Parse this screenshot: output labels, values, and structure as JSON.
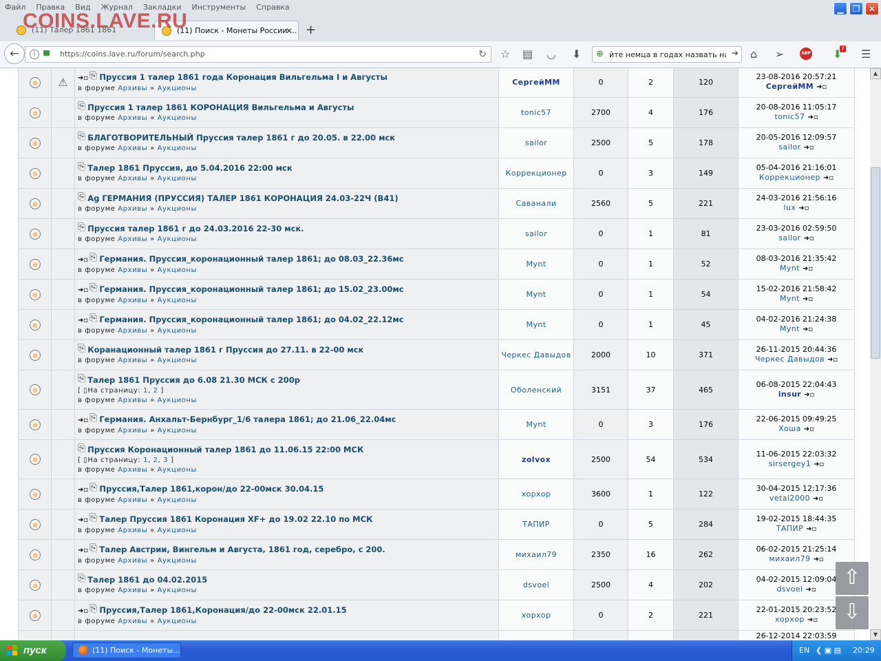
{
  "menu": [
    "Файл",
    "Правка",
    "Вид",
    "Журнал",
    "Закладки",
    "Инструменты",
    "Справка"
  ],
  "watermark": "COINS.LAVE.RU",
  "tabs": [
    {
      "label": "(11) Талер 1861 1861"
    },
    {
      "label": "(11) Поиск - Монеты России ..."
    }
  ],
  "address": {
    "url": "https://coins.lave.ru/forum/search.php"
  },
  "search": {
    "value": "йте немца в годах назвать на Du"
  },
  "toolbar": {
    "download_badge": "7",
    "adblock_label": "ABP"
  },
  "forum_label": "в форуме",
  "forum_sep": "»",
  "pages_label": "На страницу:",
  "rows": [
    {
      "id": "r1",
      "warn": true,
      "arrow": true,
      "title": "Пруссия 1 талер 1861 года Коронация Вильгельма I и Августы",
      "forum": "Архивы",
      "sub": "Аукционы",
      "author": "СергейММ",
      "author_bold": true,
      "price": "0",
      "replies": "2",
      "views": "120",
      "last_date": "23-08-2016 20:57:21",
      "last_user": "СергейММ",
      "last_bold": true
    },
    {
      "id": "r2",
      "warn": false,
      "arrow": false,
      "title": "Пруссия 1 талер 1861 КОРОНАЦИЯ Вильгельма и Августы",
      "forum": "Архивы",
      "sub": "Аукционы",
      "author": "tonic57",
      "author_bold": false,
      "price": "2700",
      "replies": "4",
      "views": "176",
      "last_date": "20-08-2016 11:05:17",
      "last_user": "tonic57",
      "last_bold": false
    },
    {
      "id": "r3",
      "warn": false,
      "arrow": false,
      "title": "БЛАГОТВОРИТЕЛЬНЫЙ Пруссия талер 1861 г до 20.05. в 22.00 мск",
      "forum": "Архивы",
      "sub": "Аукционы",
      "author": "sailor",
      "author_bold": false,
      "price": "2500",
      "replies": "5",
      "views": "178",
      "last_date": "20-05-2016 12:09:57",
      "last_user": "sailor",
      "last_bold": false
    },
    {
      "id": "r4",
      "warn": false,
      "arrow": false,
      "title": "Талер 1861 Пруссия, до 5.04.2016 22:00 мск",
      "forum": "Архивы",
      "sub": "Аукционы",
      "author": "Коррекционер",
      "author_bold": false,
      "price": "0",
      "replies": "3",
      "views": "149",
      "last_date": "05-04-2016 21:16:01",
      "last_user": "Коррекционер",
      "last_bold": false
    },
    {
      "id": "r5",
      "warn": false,
      "arrow": false,
      "title": "Ag ГЕРМАНИЯ (ПРУССИЯ) ТАЛЕР 1861 КОРОНАЦИЯ 24.03-22Ч (В41)",
      "forum": "Архивы",
      "sub": "Аукционы",
      "author": "Саванали",
      "author_bold": false,
      "price": "2560",
      "replies": "5",
      "views": "221",
      "last_date": "24-03-2016 21:56:16",
      "last_user": "lux",
      "last_bold": false
    },
    {
      "id": "r6",
      "warn": false,
      "arrow": false,
      "title": "Пруссия талер 1861 г до 24.03.2016 22-30 мск.",
      "forum": "Архивы",
      "sub": "Аукционы",
      "author": "sailor",
      "author_bold": false,
      "price": "0",
      "replies": "1",
      "views": "81",
      "last_date": "23-03-2016 02:59:50",
      "last_user": "sailor",
      "last_bold": false
    },
    {
      "id": "r7",
      "warn": false,
      "arrow": true,
      "title": "Германия. Пруссия_коронационный талер 1861; до 08.03_22.36мс",
      "forum": "Архивы",
      "sub": "Аукционы",
      "author": "Mynt",
      "author_bold": false,
      "price": "0",
      "replies": "1",
      "views": "52",
      "last_date": "08-03-2016 21:35:42",
      "last_user": "Mynt",
      "last_bold": false
    },
    {
      "id": "r8",
      "warn": false,
      "arrow": true,
      "title": "Германия. Пруссия_коронационный талер 1861; до 15.02_23.00мс",
      "forum": "Архивы",
      "sub": "Аукционы",
      "author": "Mynt",
      "author_bold": false,
      "price": "0",
      "replies": "1",
      "views": "54",
      "last_date": "15-02-2016 21:58:42",
      "last_user": "Mynt",
      "last_bold": false
    },
    {
      "id": "r9",
      "warn": false,
      "arrow": true,
      "title": "Германия. Пруссия_коронационный талер 1861; до 04.02_22.12мс",
      "forum": "Архивы",
      "sub": "Аукционы",
      "author": "Mynt",
      "author_bold": false,
      "price": "0",
      "replies": "1",
      "views": "45",
      "last_date": "04-02-2016 21:24:38",
      "last_user": "Mynt",
      "last_bold": false
    },
    {
      "id": "r10",
      "warn": false,
      "arrow": false,
      "title": "Коранационный талер 1861 г Пруссия до 27.11. в 22-00 мск",
      "forum": "Архивы",
      "sub": "Аукционы",
      "author": "Черкес Давыдов",
      "author_bold": false,
      "price": "2000",
      "replies": "10",
      "views": "371",
      "last_date": "26-11-2015 20:44:36",
      "last_user": "Черкес Давыдов",
      "last_bold": false
    },
    {
      "id": "r11",
      "warn": false,
      "arrow": false,
      "title": "Талер 1861 Пруссия до 6.08 21.30 МСК с 200р",
      "pages": [
        "1",
        "2"
      ],
      "forum": "Архивы",
      "sub": "Аукционы",
      "author": "Оболенский",
      "author_bold": false,
      "price": "3151",
      "replies": "37",
      "views": "465",
      "last_date": "06-08-2015 22:04:43",
      "last_user": "insur",
      "last_bold": true
    },
    {
      "id": "r12",
      "warn": false,
      "arrow": true,
      "title": "Германия. Анхальт-Бернбург_1/6 талера 1861; до 21.06_22.04мс",
      "forum": "Архивы",
      "sub": "Аукционы",
      "author": "Mynt",
      "author_bold": false,
      "price": "0",
      "replies": "3",
      "views": "176",
      "last_date": "22-06-2015 09:49:25",
      "last_user": "Хоша",
      "last_bold": false
    },
    {
      "id": "r13",
      "warn": false,
      "arrow": false,
      "title": "Пруссия Коронационный талер 1861 до 11.06.15 22:00 МСК",
      "pages": [
        "1",
        "2",
        "3"
      ],
      "forum": "Архивы",
      "sub": "Аукционы",
      "author": "zolvox",
      "author_bold": true,
      "price": "2500",
      "replies": "54",
      "views": "534",
      "last_date": "11-06-2015 22:03:32",
      "last_user": "sirsergey1",
      "last_bold": false
    },
    {
      "id": "r14",
      "warn": false,
      "arrow": true,
      "title": "Пруссия,Талер 1861,корон/до 22-00мск 30.04.15",
      "forum": "Архивы",
      "sub": "Аукционы",
      "author": "хорхор",
      "author_bold": false,
      "price": "3600",
      "replies": "1",
      "views": "122",
      "last_date": "30-04-2015 12:17:36",
      "last_user": "vetal2000",
      "last_bold": false
    },
    {
      "id": "r15",
      "warn": false,
      "arrow": true,
      "title": "Талер Пруссия 1861 Коронация XF+ до 19.02 22.10 по МСК",
      "forum": "Архивы",
      "sub": "Аукционы",
      "author": "ТАПИР",
      "author_bold": false,
      "price": "0",
      "replies": "5",
      "views": "284",
      "last_date": "19-02-2015 18:44:35",
      "last_user": "ТАПИР",
      "last_bold": false
    },
    {
      "id": "r16",
      "warn": false,
      "arrow": true,
      "title": "Талер Австрии, Вингельм и Августа, 1861 год, серебро, с 200.",
      "forum": "Архивы",
      "sub": "Аукционы",
      "author": "михаил79",
      "author_bold": false,
      "price": "2350",
      "replies": "16",
      "views": "262",
      "last_date": "06-02-2015 21:25:14",
      "last_user": "михаил79",
      "last_bold": false
    },
    {
      "id": "r17",
      "warn": false,
      "arrow": false,
      "title": "Талер 1861 до 04.02.2015",
      "forum": "Архивы",
      "sub": "Аукционы",
      "author": "dsvoel",
      "author_bold": false,
      "price": "2500",
      "replies": "4",
      "views": "202",
      "last_date": "04-02-2015 12:09:04",
      "last_user": "dsvoel",
      "last_bold": false
    },
    {
      "id": "r18",
      "warn": false,
      "arrow": true,
      "title": "Пруссия,Талер 1861,Коронация/до 22-00мск 22.01.15",
      "forum": "Архивы",
      "sub": "Аукционы",
      "author": "хорхор",
      "author_bold": false,
      "price": "0",
      "replies": "2",
      "views": "221",
      "last_date": "22-01-2015 20:23:52",
      "last_user": "хорхор",
      "last_bold": false
    }
  ],
  "partial_row": {
    "last_date": "26-12-2014 22:03:59"
  },
  "taskbar": {
    "start_label": "пуск",
    "task_label": "(11) Поиск - Монеты...",
    "lang": "EN",
    "clock": "20:29"
  }
}
